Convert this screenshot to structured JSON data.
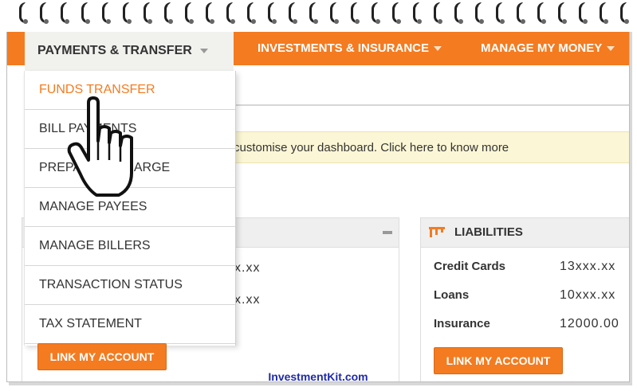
{
  "nav": {
    "active": "PAYMENTS & TRANSFER",
    "items": [
      "INVESTMENTS & INSURANCE",
      "MANAGE MY MONEY"
    ]
  },
  "dropdown": {
    "items": [
      "FUNDS TRANSFER",
      "BILL PAYMENTS",
      "PREPAID RECHARGE",
      "MANAGE PAYEES",
      "MANAGE BILLERS",
      "TRANSACTION STATUS",
      "TAX STATEMENT"
    ]
  },
  "notice": "customise your dashboard. Click here to know more",
  "assets": {
    "values": [
      "x.xx",
      "x.xx"
    ],
    "link_label": "LINK MY ACCOUNT"
  },
  "liabilities": {
    "title": "LIABILITIES",
    "rows": [
      {
        "label": "Credit Cards",
        "value": "13xxx.xx"
      },
      {
        "label": "Loans",
        "value": "10xxx.xx"
      },
      {
        "label": "Insurance",
        "value": "12000.00"
      }
    ],
    "link_label": "LINK MY ACCOUNT"
  },
  "footer": "InvestmentKit.com",
  "colors": {
    "accent": "#f47b20",
    "footer_text": "#1f2ba8"
  },
  "icons": [
    "pointing-hand-cursor-icon",
    "liabilities-icon",
    "caret-down-icon",
    "minimize-icon"
  ]
}
